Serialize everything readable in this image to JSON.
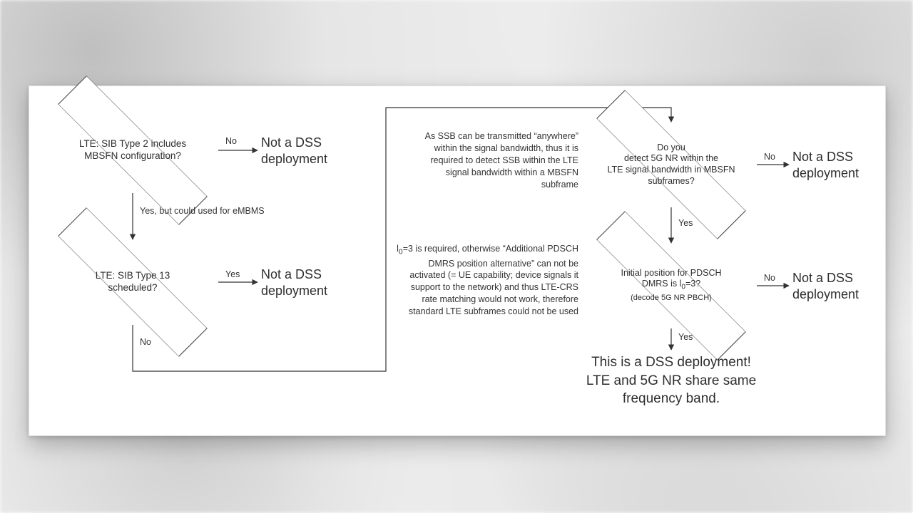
{
  "decisions": {
    "d1": "LTE: SIB Type 2 includes MBSFN configuration?",
    "d2": "LTE: SIB Type 13 scheduled?",
    "d3": "Do you\ndetect 5G NR within the\nLTE signal bandwidth in MBSFN subframes?",
    "d4_pre": "Initial position for PDSCH DMRS is l",
    "d4_post": "=3?",
    "d4_sublabel": "(decode 5G NR PBCH)"
  },
  "edges": {
    "no": "No",
    "yes": "Yes",
    "yes_embms": "Yes, but could used for eMBMS"
  },
  "results": {
    "not_dss": "Not a DSS deployment"
  },
  "notes": {
    "n1": "As SSB can be transmitted “anywhere” within the signal bandwidth, thus it is required to detect SSB within the LTE signal bandwidth within a MBSFN subframe",
    "n2_pre": "l",
    "n2_post": "=3 is required, otherwise “Additional PDSCH DMRS position alternative” can not be activated (= UE capability; device signals it support to the network) and thus LTE-CRS rate matching would not work, therefore standard LTE subframes could not be used"
  },
  "final": "This is a DSS deployment!\nLTE and 5G NR share same frequency band."
}
